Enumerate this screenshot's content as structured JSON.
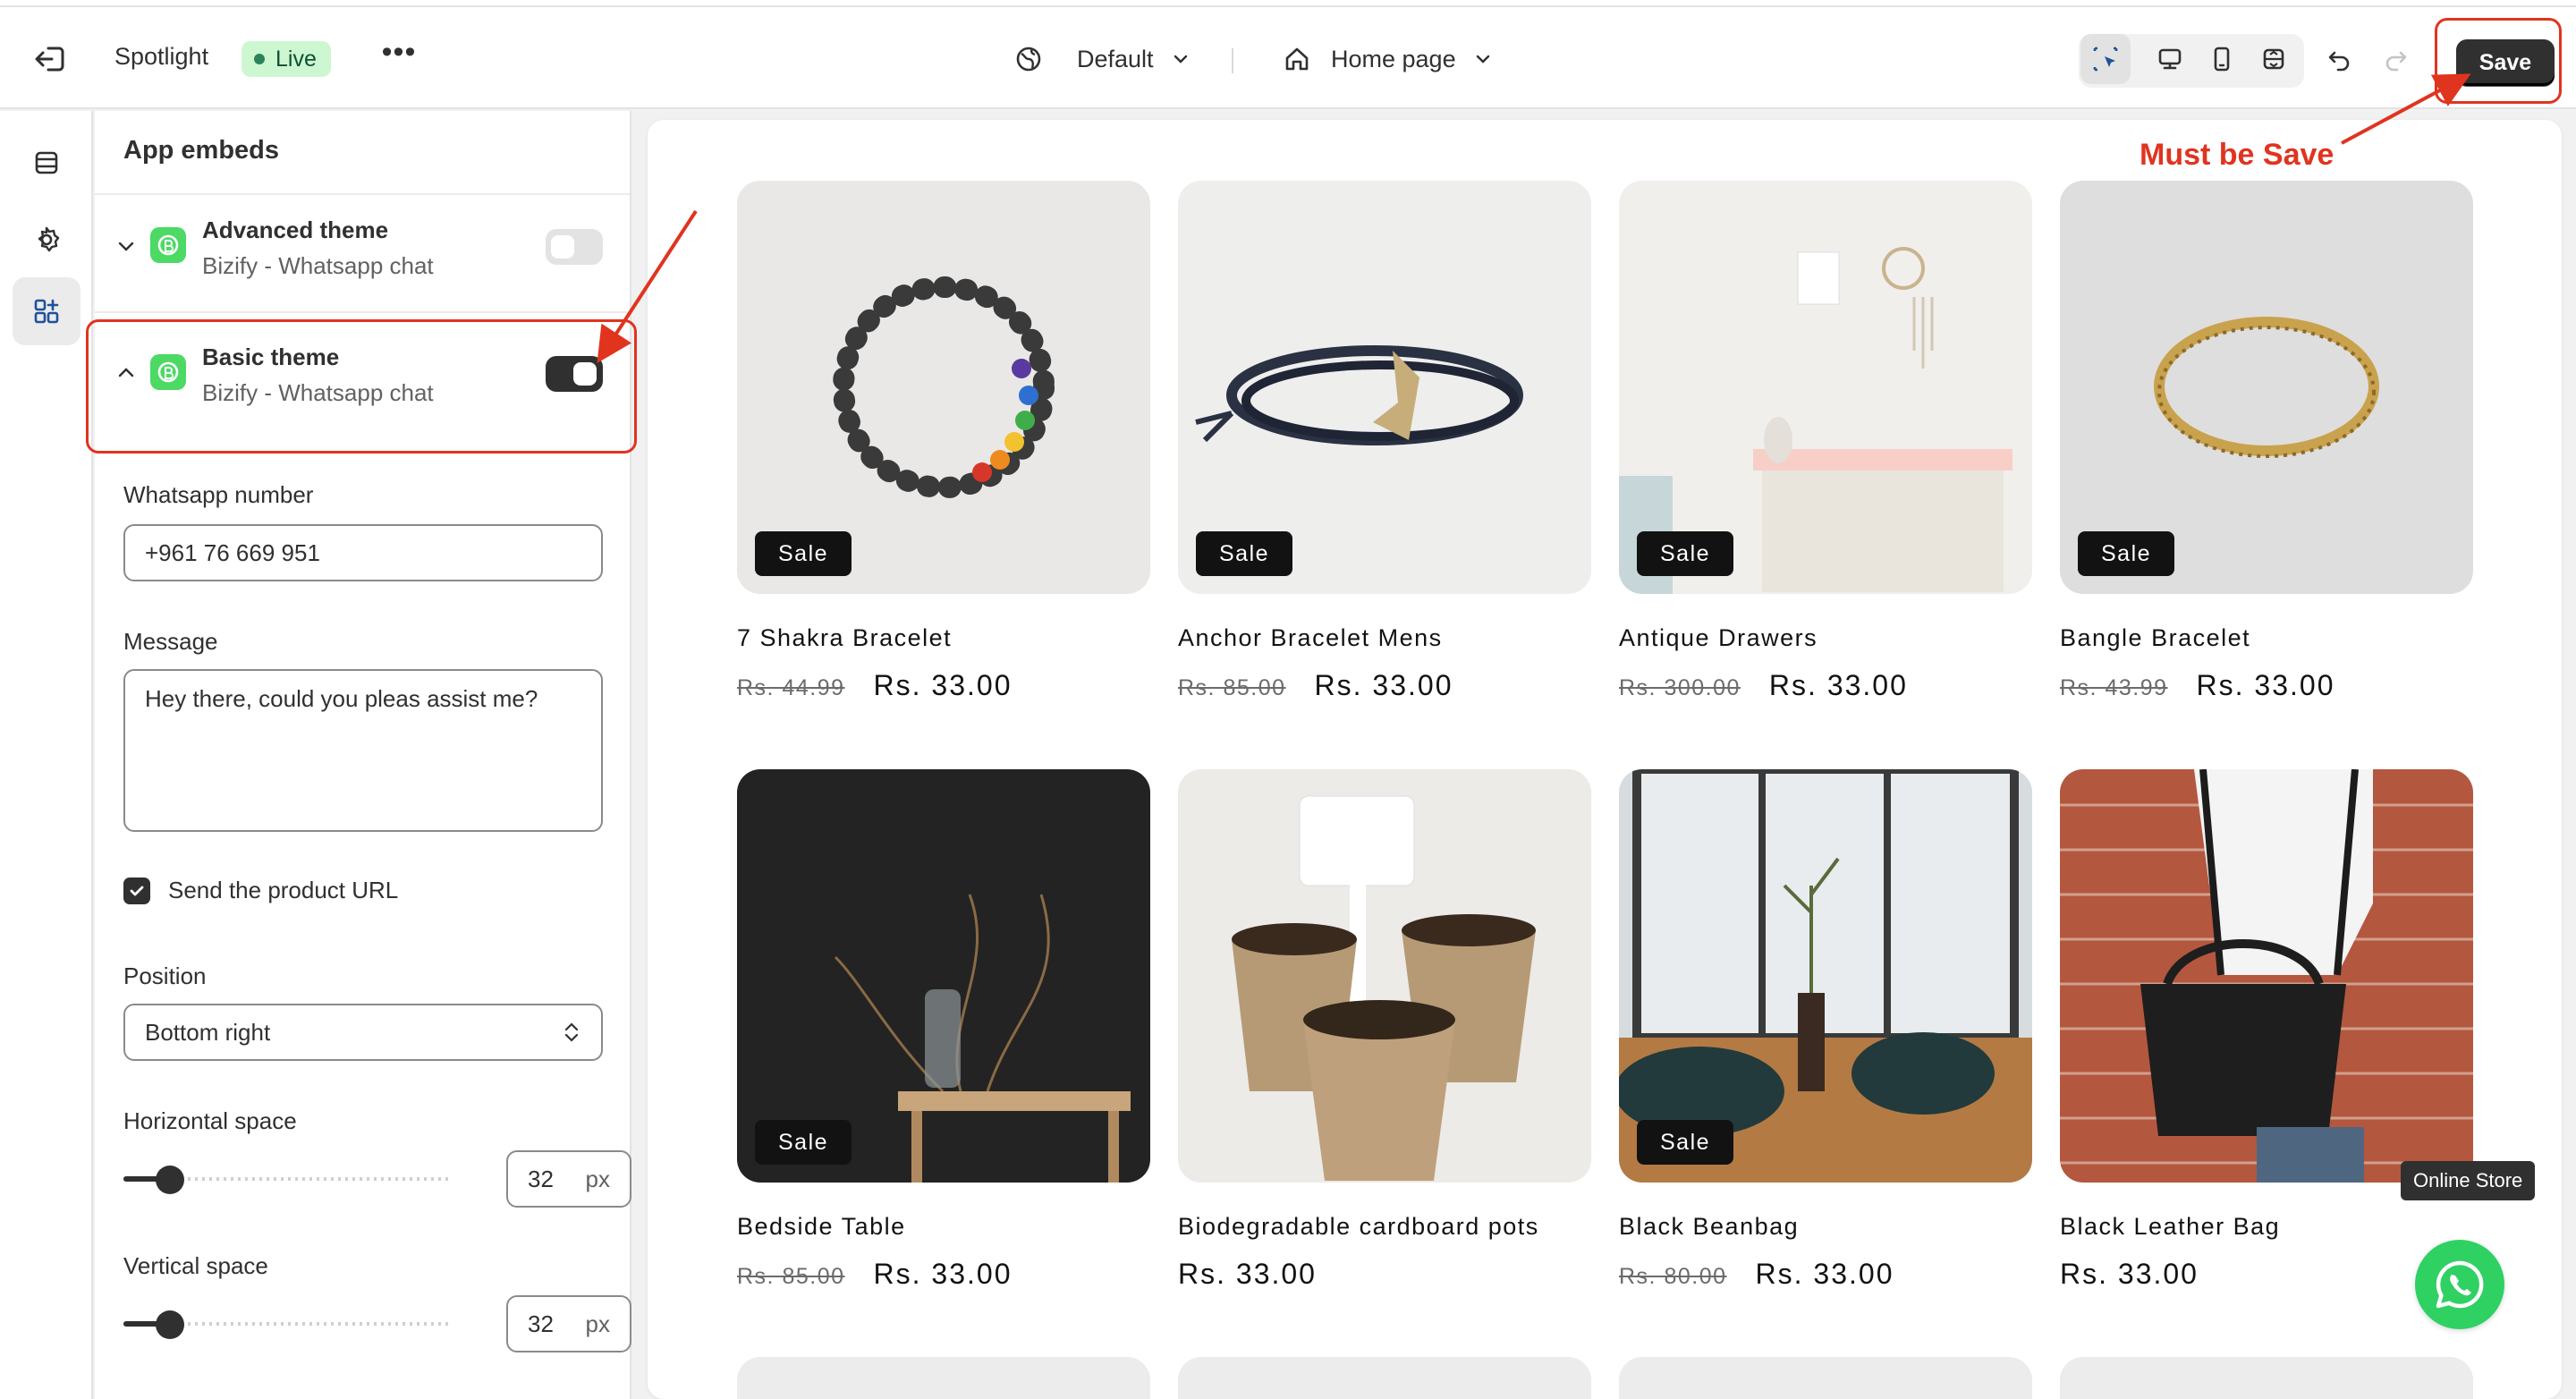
{
  "topbar": {
    "exit_icon": "exit-icon",
    "title": "Spotlight",
    "status": "Live",
    "more_icon": "more-horizontal-icon",
    "theme_selector": "Default",
    "page_selector": "Home page",
    "save_label": "Save"
  },
  "rail": {
    "items": [
      "sections-icon",
      "settings-gear-icon",
      "app-embeds-icon"
    ],
    "active": "app-embeds-icon"
  },
  "panel": {
    "title": "App embeds",
    "embeds": [
      {
        "name": "Advanced theme",
        "subtitle": "Bizify - Whatsapp chat",
        "enabled": false,
        "expanded": false
      },
      {
        "name": "Basic theme",
        "subtitle": "Bizify - Whatsapp chat",
        "enabled": true,
        "expanded": true
      }
    ],
    "whatsapp_label": "Whatsapp number",
    "whatsapp_value": "+961 76 669 951",
    "message_label": "Message",
    "message_value": "Hey there, could you pleas assist me?",
    "send_url_label": "Send the product URL",
    "send_url_checked": true,
    "position_label": "Position",
    "position_value": "Bottom right",
    "horizontal_label": "Horizontal space",
    "horizontal_value": "32",
    "vertical_label": "Vertical space",
    "vertical_value": "32",
    "unit": "px",
    "slider_fraction": 0.1
  },
  "products": [
    {
      "title": "7 Shakra Bracelet",
      "old_price": "Rs. 44.99",
      "price": "Rs. 33.00",
      "sale_badge": "Sale"
    },
    {
      "title": "Anchor Bracelet Mens",
      "old_price": "Rs. 85.00",
      "price": "Rs. 33.00",
      "sale_badge": "Sale"
    },
    {
      "title": "Antique Drawers",
      "old_price": "Rs. 300.00",
      "price": "Rs. 33.00",
      "sale_badge": "Sale"
    },
    {
      "title": "Bangle Bracelet",
      "old_price": "Rs. 43.99",
      "price": "Rs. 33.00",
      "sale_badge": "Sale"
    },
    {
      "title": "Bedside Table",
      "old_price": "Rs. 85.00",
      "price": "Rs. 33.00",
      "sale_badge": "Sale"
    },
    {
      "title": "Biodegradable cardboard pots",
      "old_price": "",
      "price": "Rs. 33.00",
      "sale_badge": ""
    },
    {
      "title": "Black Beanbag",
      "old_price": "Rs. 80.00",
      "price": "Rs. 33.00",
      "sale_badge": "Sale"
    },
    {
      "title": "Black Leather Bag",
      "old_price": "",
      "price": "Rs. 33.00",
      "sale_badge": ""
    }
  ],
  "tooltip": "Online Store",
  "annotation": "Must be Save",
  "colors": {
    "accent_red": "#e0341f",
    "live_green": "#cdf7d1",
    "whatsapp_green": "#2fd163",
    "dark": "#303030"
  }
}
